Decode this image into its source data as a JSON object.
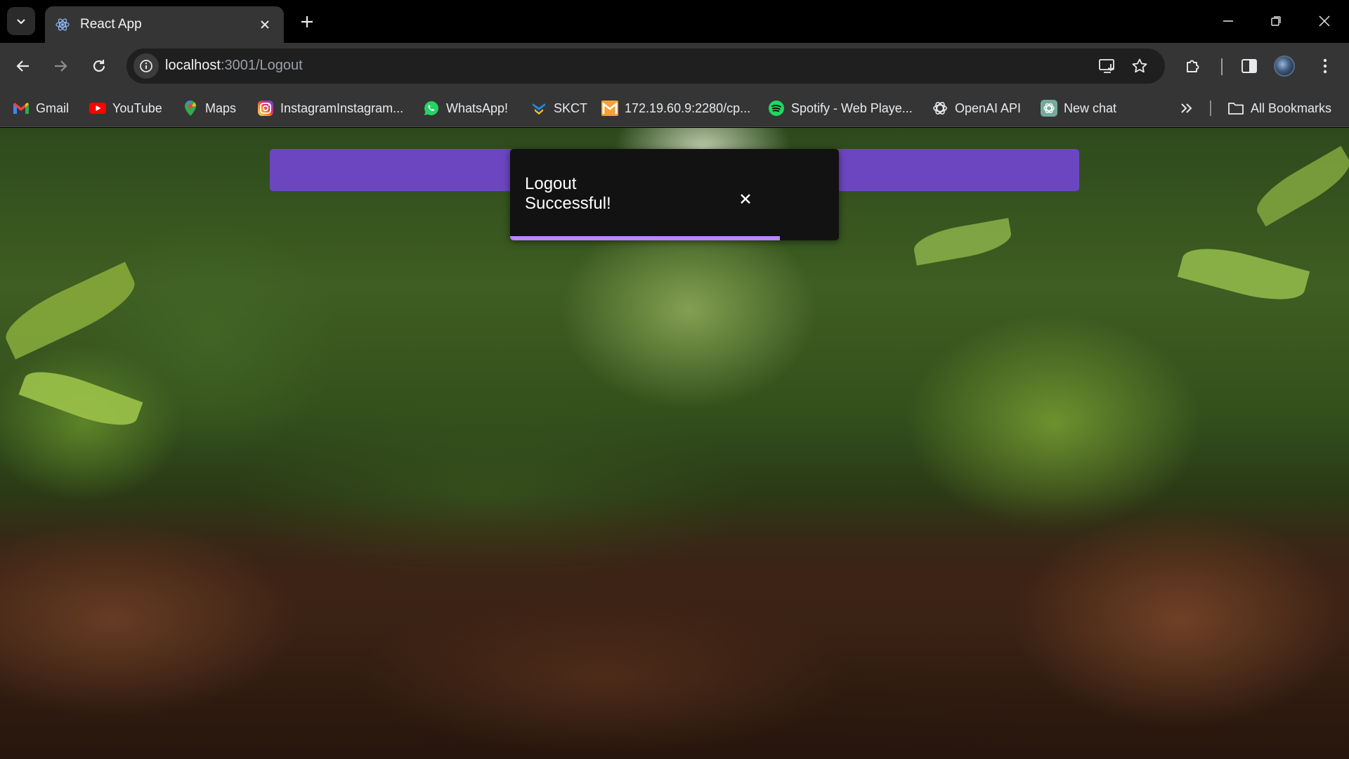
{
  "browser": {
    "tab": {
      "title": "React App",
      "favicon": "react-icon"
    },
    "address": {
      "host": "localhost",
      "path": ":3001/Logout"
    },
    "bookmarks": [
      {
        "label": "Gmail",
        "icon": "gmail-icon"
      },
      {
        "label": "YouTube",
        "icon": "youtube-icon"
      },
      {
        "label": "Maps",
        "icon": "maps-icon"
      },
      {
        "label": "InstagramInstagram...",
        "icon": "instagram-icon"
      },
      {
        "label": "WhatsApp!",
        "icon": "whatsapp-icon"
      },
      {
        "label": "SKCT",
        "icon": "skct-icon"
      },
      {
        "label": "172.19.60.9:2280/cp...",
        "icon": "gmail-m-icon"
      },
      {
        "label": "Spotify - Web Playe...",
        "icon": "spotify-icon"
      },
      {
        "label": "OpenAI API",
        "icon": "openai-icon"
      },
      {
        "label": "New chat",
        "icon": "chatgpt-icon"
      }
    ],
    "all_bookmarks": "All Bookmarks"
  },
  "page": {
    "banner_color": "#6c46c1",
    "toast": {
      "message": "Logout\nSuccessful!",
      "progress": 0.82,
      "progress_color": "#bb86fc",
      "close_icon": "close-icon"
    }
  }
}
